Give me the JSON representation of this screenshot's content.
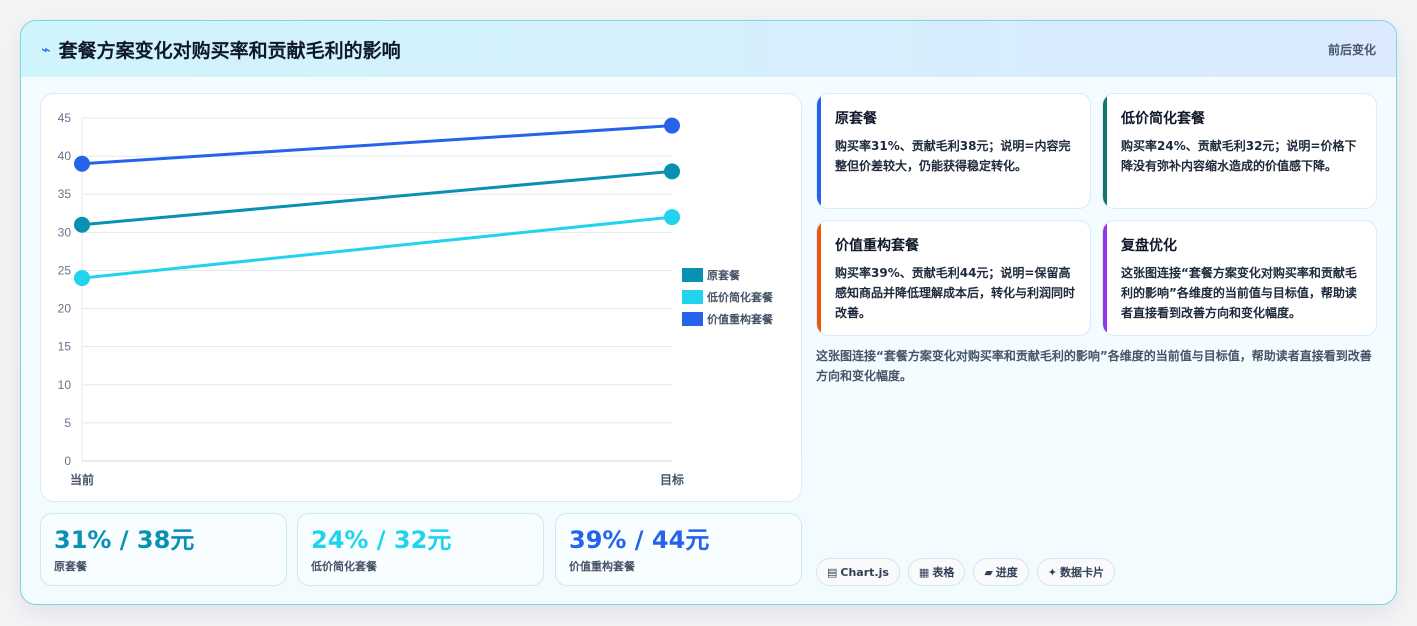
{
  "header": {
    "icon": "⌁",
    "title": "套餐方案变化对购买率和贡献毛利的影响",
    "right_label": "前后变化"
  },
  "chart_data": {
    "type": "line",
    "categories": [
      "当前",
      "目标"
    ],
    "series": [
      {
        "name": "原套餐",
        "values": [
          31,
          38
        ],
        "color": "#0891b2"
      },
      {
        "name": "低价简化套餐",
        "values": [
          24,
          32
        ],
        "color": "#22d3ee"
      },
      {
        "name": "价值重构套餐",
        "values": [
          39,
          44
        ],
        "color": "#2563eb"
      }
    ],
    "ylim": [
      0,
      45
    ],
    "yticks": [
      0,
      5,
      10,
      15,
      20,
      25,
      30,
      35,
      40,
      45
    ],
    "grid": true,
    "legend": "right"
  },
  "stats": [
    {
      "value": "31% / 38元",
      "label": "原套餐",
      "color": "#0891b2"
    },
    {
      "value": "24% / 32元",
      "label": "低价简化套餐",
      "color": "#22d3ee"
    },
    {
      "value": "39% / 44元",
      "label": "价值重构套餐",
      "color": "#2563eb"
    }
  ],
  "notes": [
    {
      "title": "原套餐",
      "text": "购买率31%、贡献毛利38元；说明=内容完整但价差较大，仍能获得稳定转化。",
      "accent": "#2563eb"
    },
    {
      "title": "低价简化套餐",
      "text": "购买率24%、贡献毛利32元；说明=价格下降没有弥补内容缩水造成的价值感下降。",
      "accent": "#0f766e"
    },
    {
      "title": "价值重构套餐",
      "text": "购买率39%、贡献毛利44元；说明=保留高感知商品并降低理解成本后，转化与利润同时改善。",
      "accent": "#ea580c"
    },
    {
      "title": "复盘优化",
      "text": "这张图连接“套餐方案变化对购买率和贡献毛利的影响”各维度的当前值与目标值，帮助读者直接看到改善方向和变化幅度。",
      "accent": "#9333ea"
    }
  ],
  "description": "这张图连接“套餐方案变化对购买率和贡献毛利的影响”各维度的当前值与目标值，帮助读者直接看到改善方向和变化幅度。",
  "tags": [
    {
      "icon": "▤",
      "label": "Chart.js"
    },
    {
      "icon": "▦",
      "label": "表格"
    },
    {
      "icon": "▰",
      "label": "进度"
    },
    {
      "icon": "✦",
      "label": "数据卡片"
    }
  ]
}
